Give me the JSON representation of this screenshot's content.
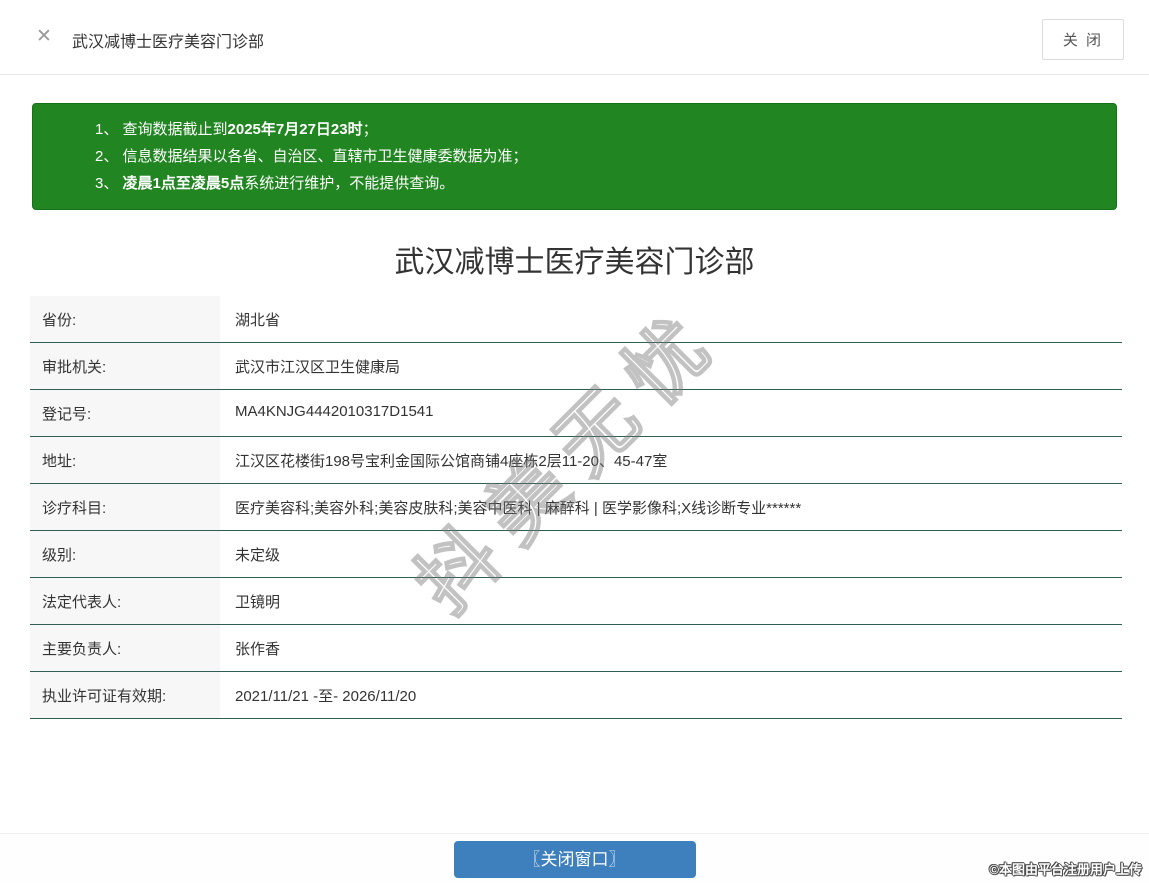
{
  "colors": {
    "notice_green": "#218521",
    "notice_green_dark": "#17701a",
    "divider_teal": "#2e5e54",
    "label_bg": "#f7f7f7",
    "button_blue": "#3e80bd"
  },
  "header": {
    "close_icon": "✕",
    "title": "武汉减博士医疗美容门诊部",
    "close_button_label": "关 闭"
  },
  "notice": {
    "lines": [
      {
        "segments": [
          {
            "text": "1、 查询数据截止到",
            "bold": false
          },
          {
            "text": "2025年7月27日23时",
            "bold": true
          },
          {
            "text": "；",
            "bold": false
          }
        ]
      },
      {
        "segments": [
          {
            "text": "2、 信息数据结果以各省、自治区、直辖市卫生健康委数据为准；",
            "bold": false
          }
        ]
      },
      {
        "segments": [
          {
            "text": "3、 ",
            "bold": false
          },
          {
            "text": "凌晨1点至凌晨5点",
            "bold": true
          },
          {
            "text": "系统进行维护，不能提供查询。",
            "bold": false
          }
        ]
      }
    ]
  },
  "main": {
    "title": "武汉减博士医疗美容门诊部"
  },
  "info_table": {
    "rows": [
      {
        "label": "省份:",
        "value": "湖北省"
      },
      {
        "label": "审批机关:",
        "value": "武汉市江汉区卫生健康局"
      },
      {
        "label": "登记号:",
        "value": "MA4KNJG4442010317D1541"
      },
      {
        "label": "地址:",
        "value": "江汉区花楼街198号宝利金国际公馆商铺4座栋2层11-20、45-47室"
      },
      {
        "label": "诊疗科目:",
        "value": "医疗美容科;美容外科;美容皮肤科;美容中医科 | 麻醉科 | 医学影像科;X线诊断专业******"
      },
      {
        "label": "级别:",
        "value": "未定级"
      },
      {
        "label": "法定代表人:",
        "value": "卫镜明"
      },
      {
        "label": "主要负责人:",
        "value": "张作香"
      },
      {
        "label": "执业许可证有效期:",
        "value": "2021/11/21 -至- 2026/11/20"
      }
    ]
  },
  "watermark": {
    "text": "抖美无忧"
  },
  "footer": {
    "close_window_button": "〖关闭窗口〗",
    "copyright": "©本图由平台注册用户上传"
  }
}
